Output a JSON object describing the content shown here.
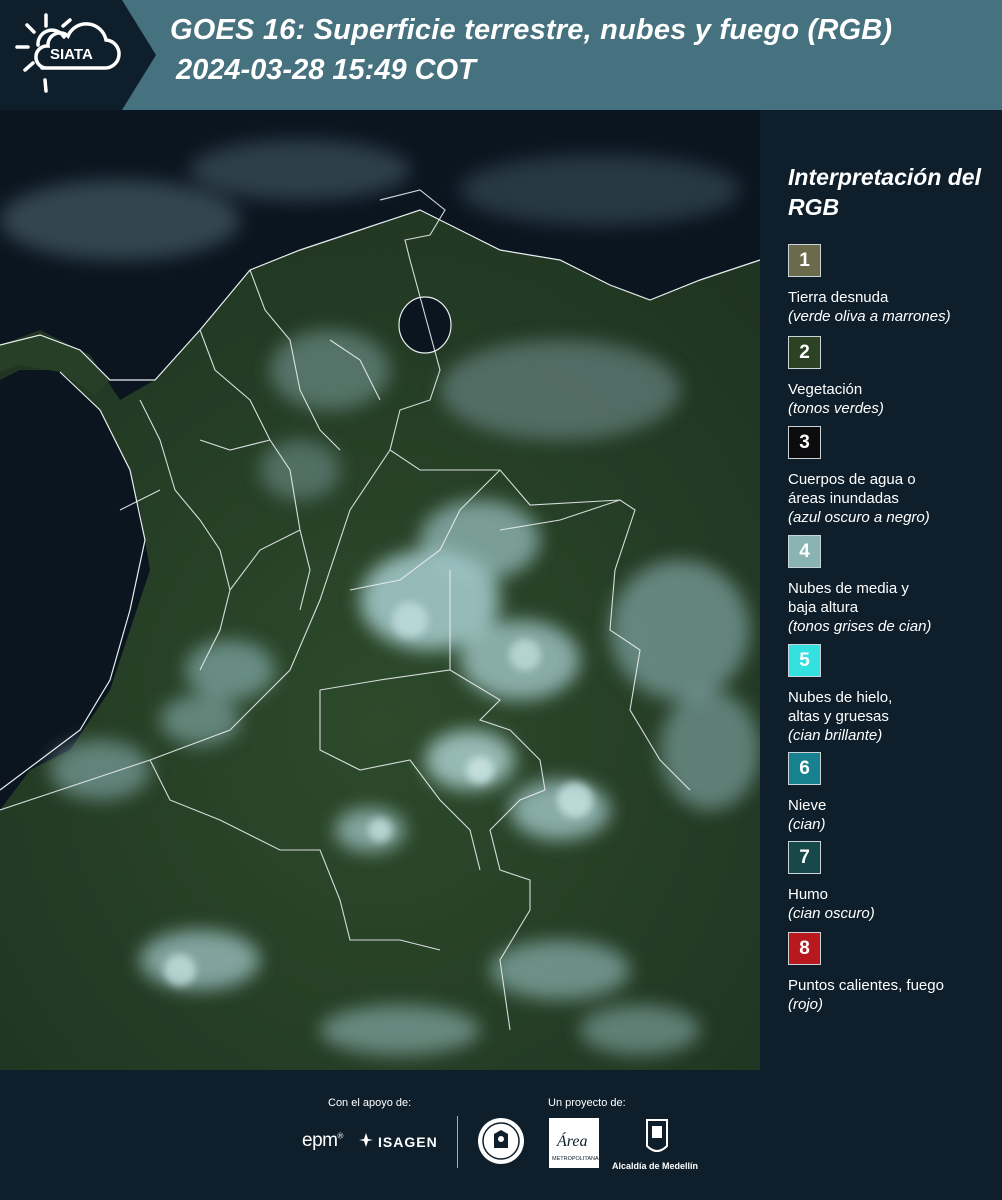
{
  "header": {
    "logo_text": "SIATA",
    "title": "GOES 16: Superficie terrestre, nubes y fuego (RGB)",
    "timestamp": "2024-03-28 15:49 COT"
  },
  "legend": {
    "title": "Interpretación del RGB",
    "items": [
      {
        "number": "1",
        "label": "Tierra desnuda",
        "desc": "(verde oliva a marrones)",
        "color": "#6b6a4a"
      },
      {
        "number": "2",
        "label": "Vegetación",
        "desc": "(tonos verdes)",
        "color": "#2c4223"
      },
      {
        "number": "3",
        "label": "Cuerpos de agua o áreas inundadas",
        "desc": "(azul oscuro a negro)",
        "color": "#0c0c0f"
      },
      {
        "number": "4",
        "label": "Nubes de media y baja altura",
        "desc": "(tonos grises de cian)",
        "color": "#8ab3b3"
      },
      {
        "number": "5",
        "label": "Nubes de hielo, altas y gruesas",
        "desc": "(cian brillante)",
        "color": "#33e1e1"
      },
      {
        "number": "6",
        "label": "Nieve",
        "desc": "(cian)",
        "color": "#17818f"
      },
      {
        "number": "7",
        "label": "Humo",
        "desc": "(cian oscuro)",
        "color": "#17494b"
      },
      {
        "number": "8",
        "label": "Puntos calientes, fuego",
        "desc": "(rojo)",
        "color": "#b8191f"
      }
    ]
  },
  "footer": {
    "support_label": "Con el apoyo de:",
    "project_label": "Un proyecto de:",
    "sponsor_1": "epm",
    "sponsor_2": "ISAGEN",
    "area_logo_text": "Área",
    "area_logo_sub": "METROPOLITANA",
    "alcaldia": "Alcaldía de Medellín"
  },
  "colors": {
    "header_bg": "#46717f",
    "page_bg": "#0e1f2b",
    "land": "#253d25",
    "water": "#0b1520",
    "cloud": "#a8cfd0",
    "border": "#e8eef0"
  }
}
